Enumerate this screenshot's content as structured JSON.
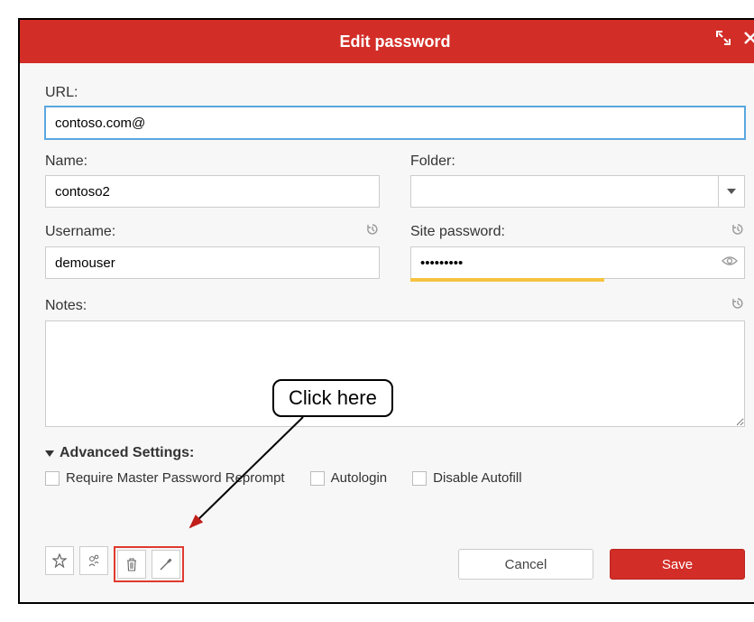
{
  "title": "Edit password",
  "labels": {
    "url": "URL:",
    "name": "Name:",
    "folder": "Folder:",
    "username": "Username:",
    "password": "Site password:",
    "notes": "Notes:",
    "advanced": "Advanced Settings:"
  },
  "values": {
    "url": "contoso.com@",
    "name": "contoso2",
    "folder": "",
    "username": "demouser",
    "password": "•••••••••",
    "notes": ""
  },
  "checks": {
    "reprompt": "Require Master Password Reprompt",
    "autologin": "Autologin",
    "disable_autofill": "Disable Autofill"
  },
  "buttons": {
    "cancel": "Cancel",
    "save": "Save"
  },
  "annotation": {
    "callout": "Click here"
  }
}
